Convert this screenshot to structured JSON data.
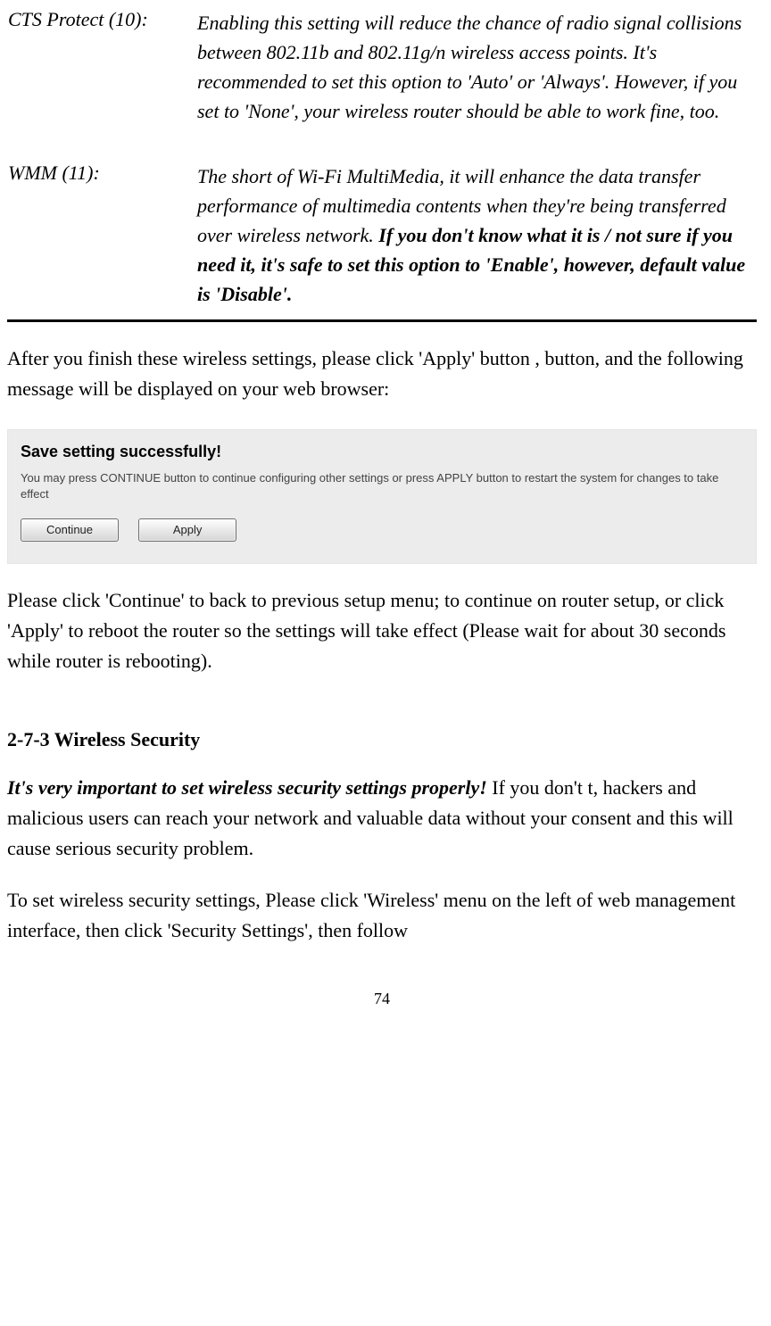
{
  "definitions": {
    "cts": {
      "label": "CTS Protect (10):",
      "desc": "Enabling this setting will reduce the chance of radio signal collisions between 802.11b and 802.11g/n wireless access points. It's recommended to set this option to 'Auto' or 'Always'. However, if you set to 'None', your wireless router should be able to work fine, too."
    },
    "wmm": {
      "label": "WMM (11):",
      "desc_prefix": "The short of Wi-Fi MultiMedia, it will enhance the data transfer performance of multimedia contents when they're being transferred over wireless network. ",
      "desc_bold": "If you don't know what it is / not sure if you need it, it's safe to set this option to 'Enable', however, default value is 'Disable'."
    }
  },
  "para_after_table": "After you finish these wireless settings, please click 'Apply' button , button, and the following message will be displayed on your web browser:",
  "dialog": {
    "title": "Save setting successfully!",
    "text": "You may press CONTINUE button to continue configuring other settings or press APPLY button to restart the system for changes to take effect",
    "continue_label": "Continue",
    "apply_label": "Apply"
  },
  "para_after_dialog": "Please click 'Continue' to back to previous setup menu; to continue on router setup, or click 'Apply' to reboot the router so the settings will take effect (Please wait for about 30 seconds while router is rebooting).",
  "section_heading": "2-7-3 Wireless Security",
  "security_para_bold": "It's very important to set wireless security settings properly!",
  "security_para_rest": " If you don't t, hackers and malicious users can reach your network and valuable data without your consent and this will cause serious security problem.",
  "security_para2": "To set wireless security settings, Please click 'Wireless' menu on the left of web management interface, then click 'Security Settings', then follow",
  "page_number": "74"
}
